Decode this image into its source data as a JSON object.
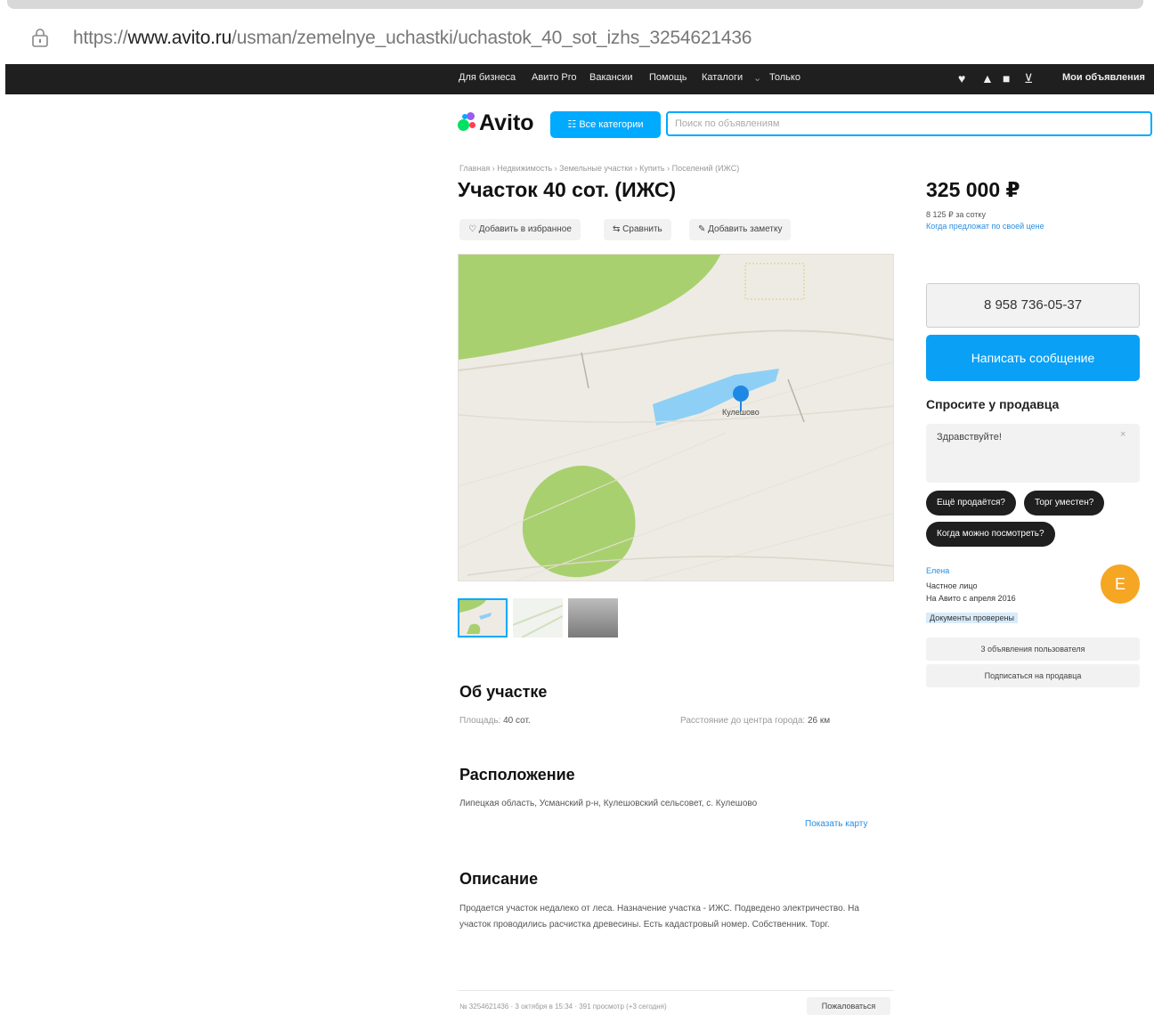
{
  "browser": {
    "url_prefix": "https://",
    "url_domain": "www.avito.ru",
    "url_path": "/usman/zemelnye_uchastki/uchastok_40_sot_izhs_3254621436"
  },
  "topnav": {
    "items": [
      "Для бизнеса",
      "Авито Pro",
      "Вакансии",
      "Помощь",
      "Каталоги",
      "Только"
    ],
    "my_ads": "Мои объявления"
  },
  "header": {
    "logo": "Avito",
    "categories_button": "Все категории",
    "search_placeholder": "Поиск по объявлениям"
  },
  "listing": {
    "breadcrumb": "Главная › Недвижимость › Земельные участки › Купить › Поселений (ИЖС)",
    "title": "Участок 40 сот. (ИЖС)",
    "actions": {
      "favorite": "Добавить в избранное",
      "compare": "Сравнить",
      "note": "Добавить заметку"
    },
    "map_label": "Кулешово",
    "about_title": "Об участке",
    "area_label": "Площадь:",
    "area_value": "40 сот.",
    "distance_label": "Расстояние до центра города:",
    "distance_value": "26 км",
    "location_title": "Расположение",
    "address": "Липецкая область, Усманский р-н, Кулешовский сельсовет, с. Кулешово",
    "show_map": "Показать карту",
    "description_title": "Описание",
    "description": "Продается участок недалеко от леса. Назначение участка - ИЖС. Подведено электричество. На участок проводились расчистка древесины. Есть кадастровый номер. Собственник. Торг.",
    "footer_meta": "№ 3254621436 · 3 октября в 15:34 · 391 просмотр (+3 сегодня)",
    "footer_button": "Пожаловаться"
  },
  "sidebar": {
    "price": "325 000 ₽",
    "price_per": "8 125 ₽ за сотку",
    "price_link": "Когда предложат по своей цене",
    "phone": "8 958 736-05-37",
    "message_button": "Написать сообщение",
    "ask_title": "Спросите у продавца",
    "ask_text": "Здравствуйте!",
    "ask_close": "×",
    "chips": [
      "Ещё продаётся?",
      "Торг уместен?",
      "Когда можно посмотреть?"
    ],
    "seller_name": "Елена",
    "seller_type": "Частное лицо",
    "seller_since": "На Авито с апреля 2016",
    "seller_doc": "Документы проверены",
    "avatar_letter": "Е",
    "seller_ads": "3 объявления пользователя",
    "subscribe": "Подписаться на продавца"
  },
  "colors": {
    "accent": "#00aaff",
    "message_button": "#0aa0f5",
    "nav_bg": "#1f1f1f",
    "avatar": "#f5a623",
    "map_green": "#a9d06e",
    "map_water": "#8ecff5",
    "map_pin": "#1e88e5"
  }
}
